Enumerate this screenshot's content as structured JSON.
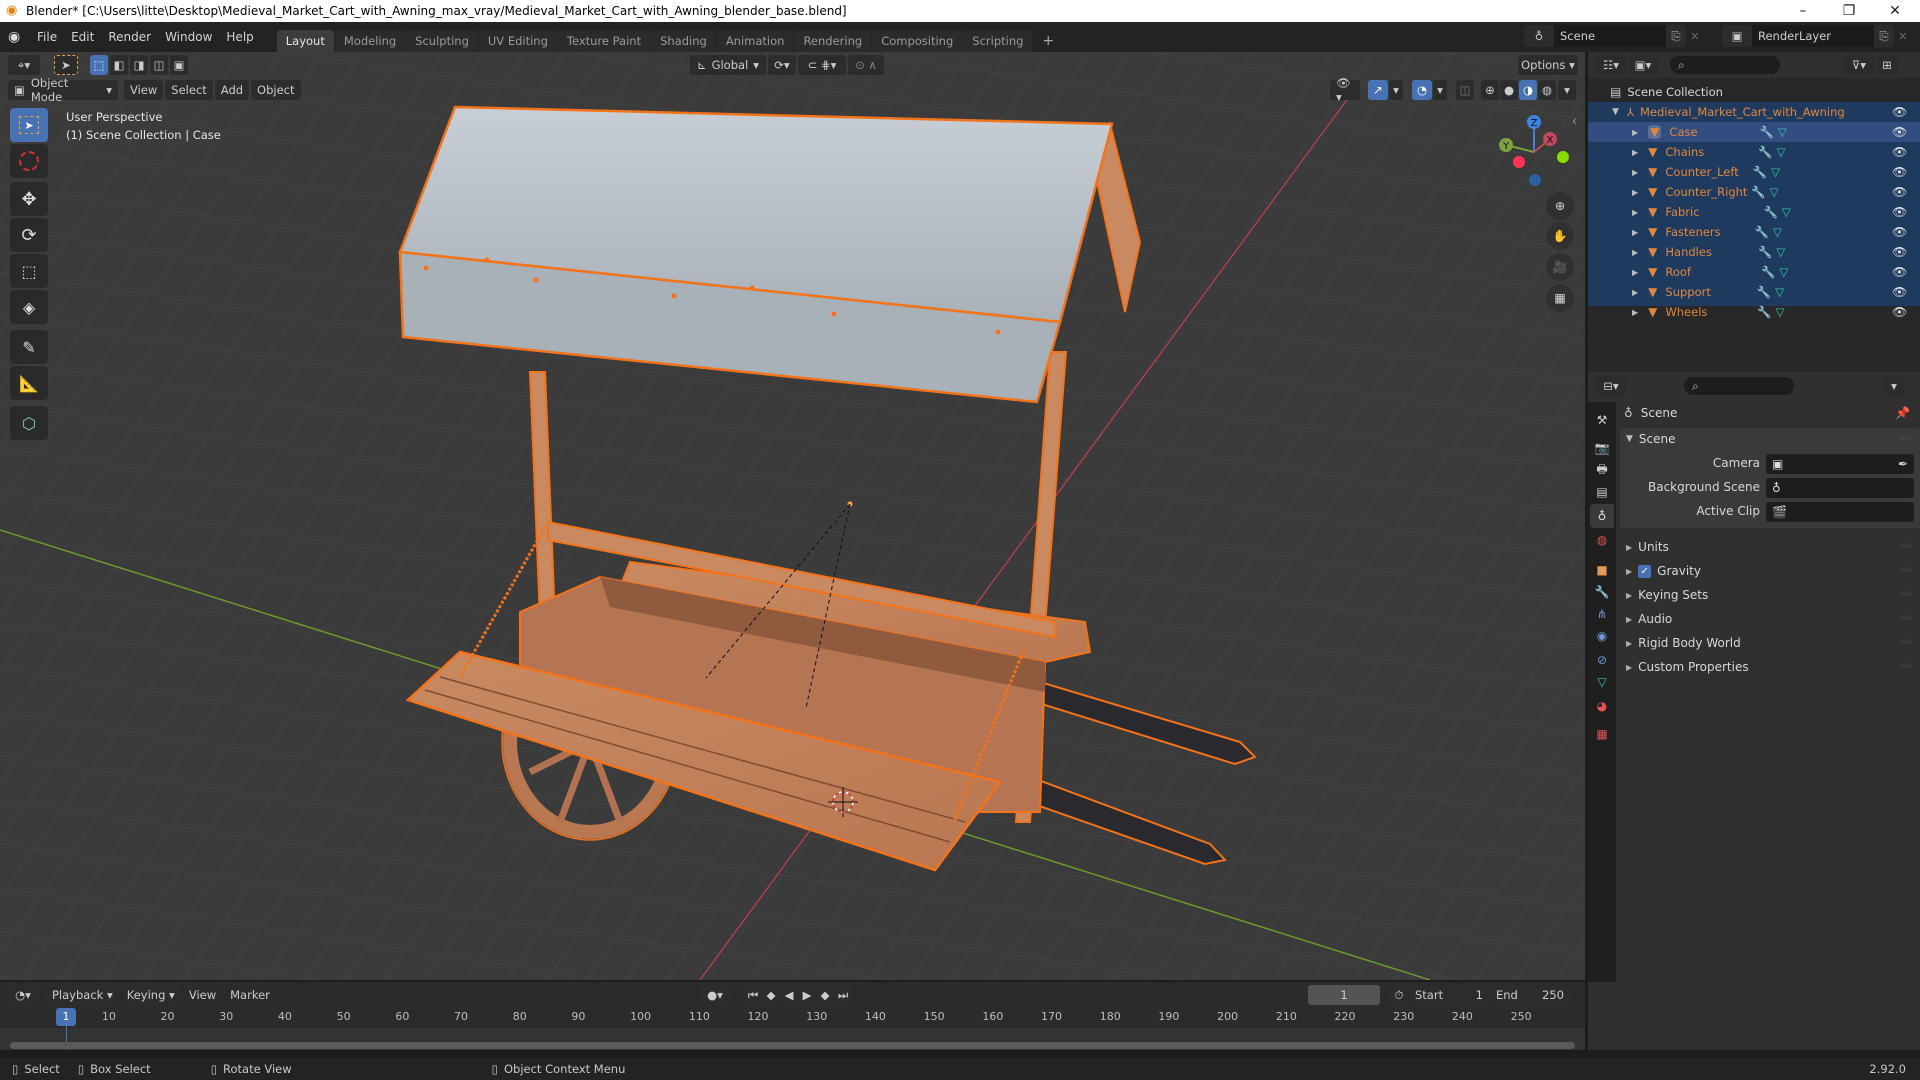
{
  "window": {
    "title": "Blender* [C:\\Users\\litte\\Desktop\\Medieval_Market_Cart_with_Awning_max_vray/Medieval_Market_Cart_with_Awning_blender_base.blend]",
    "minimize": "–",
    "restore": "❐",
    "close": "✕"
  },
  "menu": [
    "File",
    "Edit",
    "Render",
    "Window",
    "Help"
  ],
  "workspaces": {
    "active": "Layout",
    "tabs": [
      "Layout",
      "Modeling",
      "Sculpting",
      "UV Editing",
      "Texture Paint",
      "Shading",
      "Animation",
      "Rendering",
      "Compositing",
      "Scripting"
    ],
    "add": "+"
  },
  "scene_selector": {
    "value": "Scene"
  },
  "view_layer_selector": {
    "value": "RenderLayer"
  },
  "viewport": {
    "mode": "Object Mode",
    "menus": [
      "View",
      "Select",
      "Add",
      "Object"
    ],
    "transform_orientation": "Global",
    "options_label": "Options",
    "overlay_line1": "User Perspective",
    "overlay_line2": "(1) Scene Collection | Case",
    "gizmo_axes": {
      "x": "X",
      "y": "Y",
      "z": "Z"
    },
    "colors": {
      "background": "#3b3b3b",
      "x_axis": "#b8404f",
      "y_axis": "#6c9a2c",
      "selection": "#f2731a",
      "active_selection": "#ffaa40"
    },
    "tools": [
      "select-box",
      "cursor",
      "move",
      "rotate",
      "scale",
      "transform",
      "annotate",
      "measure",
      "add-cube"
    ]
  },
  "outliner": {
    "search_placeholder": "",
    "root": "Scene Collection",
    "collection": "Medieval_Market_Cart_with_Awning",
    "objects": [
      {
        "name": "Case",
        "active": true
      },
      {
        "name": "Chains",
        "active": false
      },
      {
        "name": "Counter_Left",
        "active": false
      },
      {
        "name": "Counter_Right",
        "active": false
      },
      {
        "name": "Fabric",
        "active": false
      },
      {
        "name": "Fasteners",
        "active": false
      },
      {
        "name": "Handles",
        "active": false
      },
      {
        "name": "Roof",
        "active": false
      },
      {
        "name": "Support",
        "active": false
      },
      {
        "name": "Wheels",
        "active": false
      }
    ],
    "colors": {
      "selected_bg": "#1f3a5f",
      "active_bg": "#334d80",
      "name": "#e0873e",
      "modifier": "#6f9ad6",
      "mesh": "#2fc7b0"
    }
  },
  "properties": {
    "search_placeholder": "",
    "context": "Scene",
    "scene_panel": {
      "title": "Scene",
      "camera_label": "Camera",
      "camera_value": "",
      "background_scene_label": "Background Scene",
      "background_scene_value": "",
      "active_clip_label": "Active Clip",
      "active_clip_value": ""
    },
    "collapsed_panels": [
      {
        "label": "Units",
        "checkbox": false
      },
      {
        "label": "Gravity",
        "checkbox": true,
        "checked": true
      },
      {
        "label": "Keying Sets",
        "checkbox": false
      },
      {
        "label": "Audio",
        "checkbox": false
      },
      {
        "label": "Rigid Body World",
        "checkbox": false
      },
      {
        "label": "Custom Properties",
        "checkbox": false
      }
    ],
    "tabs": [
      "tool",
      "render",
      "output",
      "view-layer",
      "scene",
      "world",
      "object",
      "modifiers",
      "particles",
      "physics",
      "constraints",
      "data",
      "material",
      "texture"
    ],
    "active_tab": "scene"
  },
  "timeline": {
    "menus": [
      "Playback",
      "Keying",
      "View",
      "Marker"
    ],
    "current_frame": "1",
    "start_label": "Start",
    "start": "1",
    "end_label": "End",
    "end": "250",
    "ticks": [
      "10",
      "20",
      "30",
      "40",
      "50",
      "60",
      "70",
      "80",
      "90",
      "100",
      "110",
      "120",
      "130",
      "140",
      "150",
      "160",
      "170",
      "180",
      "190",
      "200",
      "210",
      "220",
      "230",
      "240",
      "250"
    ],
    "playhead": "1"
  },
  "statusbar": {
    "select": "Select",
    "box_select": "Box Select",
    "rotate_view": "Rotate View",
    "context_menu": "Object Context Menu",
    "version": "2.92.0"
  }
}
